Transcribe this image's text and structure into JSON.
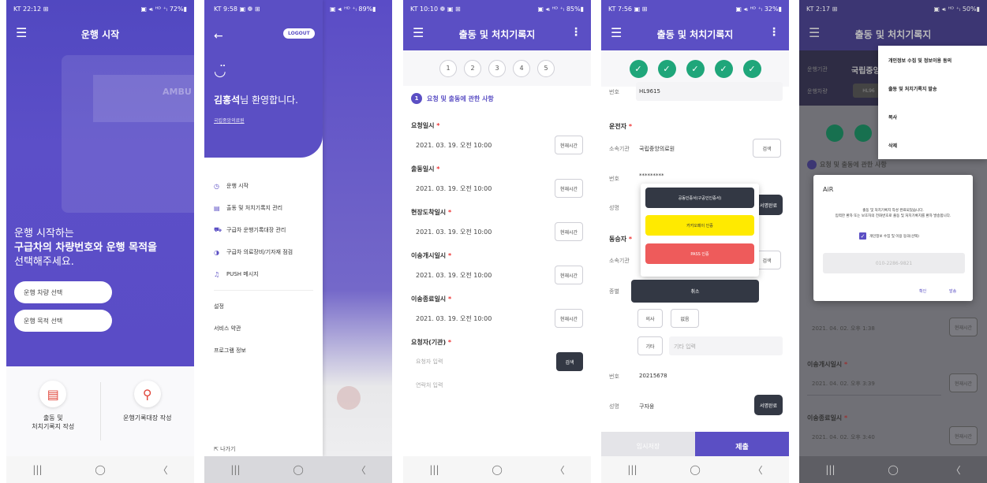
{
  "screen1": {
    "status_left": "KT 22:12 ⊞",
    "status_right": "▣ ◂ᵢ ᴴᴰ ⁺ₗ 72%▮",
    "title": "운행 시작",
    "hero_text": "AMBU",
    "headline_1": "운행 시작하는",
    "headline_2": "구급차의 차량번호와 운행 목적을",
    "headline_3": "선택해주세요.",
    "btn_vehicle": "운행 차량 선택",
    "btn_purpose": "운행 목적 선택",
    "card1_line1": "출동 및",
    "card1_line2": "처치기록지 작성",
    "card2": "운행기록대장 작성",
    "nav_recent": "|||",
    "nav_home": "◯",
    "nav_back": "〈"
  },
  "screen2": {
    "status_left": "KT 9:58 ▣ ❁ ⊞",
    "status_right": "▣ ◂ᵢ ᴴᴰ ⁺ₗ 89%▮",
    "back": "←",
    "logout": "LOGOUT",
    "smile": "◡̈",
    "welcome_name": "김홍석",
    "welcome_suffix": "님 환영합니다.",
    "org": "국립중앙의료원",
    "menu": [
      {
        "icon": "◷",
        "label": "운행 시작"
      },
      {
        "icon": "▤",
        "label": "출동 및 처치기록지 관리"
      },
      {
        "icon": "⛟",
        "label": "구급차 운행기록대장 관리"
      },
      {
        "icon": "◑",
        "label": "구급차 의료장비/기자재 점검"
      },
      {
        "icon": "♫",
        "label": "PUSH 메시지"
      }
    ],
    "settings": [
      "설정",
      "서비스 약관",
      "프로그램 정보"
    ],
    "exit": "나가기",
    "nav_recent": "|||",
    "nav_home": "◯",
    "nav_back": "〈"
  },
  "screen3": {
    "status_left": "KT 10:10 ❁ ▣ ⊞",
    "status_right": "▣ ◂ᵢ ᴴᴰ ⁺ₗ 85%▮",
    "title": "출동 및 처치기록지",
    "steps": [
      "1",
      "2",
      "3",
      "4",
      "5"
    ],
    "section_num": "1",
    "section": "요청 및 출동에 관한 사항",
    "now_label": "현재시간",
    "fields": [
      {
        "label": "요청일시",
        "value": "2021. 03. 19. 오전 10:00"
      },
      {
        "label": "출동일시",
        "value": "2021. 03. 19. 오전 10:00"
      },
      {
        "label": "현장도착일시",
        "value": "2021. 03. 19. 오전 10:00"
      },
      {
        "label": "이송개시일시",
        "value": "2021. 03. 19. 오전 10:00"
      },
      {
        "label": "이송종료일시",
        "value": "2021. 03. 19. 오전 10:00"
      }
    ],
    "requester_label": "요청자(기관)",
    "requester_ph": "요청자 입력",
    "search": "검색",
    "contact_ph": "연락처 입력",
    "req_mark": "*",
    "nav_recent": "|||",
    "nav_home": "◯",
    "nav_back": "〈"
  },
  "screen4": {
    "status_left": "KT 7:56 ▣ ⊞",
    "status_right": "▣ ◂ᵢ ᴴᴰ ⁺ₗ 32%▮",
    "title": "출동 및 처치기록지",
    "check": "✓",
    "num_label": "번호",
    "num_value": "HL9615",
    "driver": "운전자",
    "org_label": "소속기관",
    "org_value": "국립중앙의료원",
    "search": "검색",
    "num2_value": "*********",
    "name_label": "성명",
    "sign": "서명완료",
    "popup_btn1": "공동인증서(구공인인증서)",
    "popup_btn2": "카카오페이 인증",
    "popup_btn3": "PASS 인증",
    "popup_cancel": "취소",
    "rider": "동승자",
    "kind_label": "종별",
    "opt_doctor": "의사",
    "opt_none": "없음",
    "opt_other": "기타",
    "other_ph": "기타 입력",
    "num3_value": "20215678",
    "name3_value": "구자웅",
    "footer_temp": "임시저장",
    "footer_submit": "제출",
    "req_mark": "*",
    "nav_recent": "|||",
    "nav_home": "◯",
    "nav_back": "〈"
  },
  "screen5": {
    "status_left": "KT 2:17 ⊞",
    "status_right": "▣ ◂ᵢ ᴴᴰ ⁺ₗ 50%▮",
    "title": "출동 및 처치기록지",
    "org_label": "운행기관",
    "org_value": "국립중앙",
    "vehicle_label": "운행차량",
    "vehicle_value": "HL96",
    "menu": [
      "개인정보 수집 및 정보이용 동의",
      "출동 및 처치기록지 발송",
      "복사",
      "삭제"
    ],
    "section": "요청 및 출동에 관한 사항",
    "dialog_title": "AiR",
    "dialog_msg_1": "출동 및 처치기록지 작성 완료되었습니다.",
    "dialog_msg_2": "입력한 환자 또는 보호자의 전화번호로 출동 및 처치기록지를 환자 발송합니다.",
    "dialog_check": "개인정보 수집 및 이용 동의(선택)",
    "dialog_phone": "010-2286-9821",
    "dialog_ok": "확인",
    "dialog_send": "발송",
    "row_value_1": "2021. 04. 02. 오후 1:38",
    "label_2": "이송개시일시",
    "row_value_2": "2021. 04. 02. 오후 3:39",
    "label_3": "이송종료일시",
    "row_value_3": "2021. 04. 02. 오후 3:40",
    "now_label": "현재시간",
    "req_mark": "*",
    "nav_recent": "|||",
    "nav_home": "◯",
    "nav_back": "〈"
  }
}
